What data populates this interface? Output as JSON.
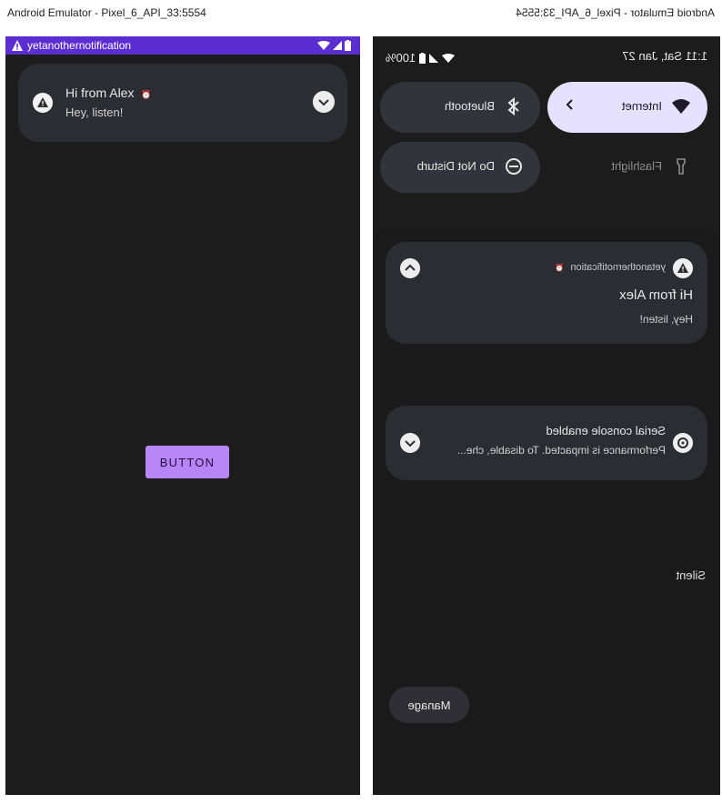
{
  "left_window": {
    "title": "Android Emulator - Pixel_6_API_33:5554",
    "app_bar": {
      "label": "yetanothernotification"
    },
    "notification": {
      "title": "Hi from Alex",
      "alarm_glyph": "⏰",
      "body": "Hey, listen!"
    },
    "button_label": "BUTTON"
  },
  "right_window": {
    "title": "Android Emulator - Pixel_6_API_33:5554",
    "status": {
      "time_date": "1:11 Sat, Jan 27",
      "battery": "100%"
    },
    "tiles": [
      {
        "label": "Internet",
        "icon": "wifi-icon",
        "state": "active"
      },
      {
        "label": "Bluetooth",
        "icon": "bluetooth-icon",
        "state": "inactive"
      },
      {
        "label": "Flashlight",
        "icon": "flashlight-icon",
        "state": "ghost"
      },
      {
        "label": "Do Not Disturb",
        "icon": "dnd-icon",
        "state": "inactive"
      }
    ],
    "notification": {
      "app": "yetanothernotification",
      "alarm_glyph": "⏰",
      "title": "Hi from Alex",
      "body": "Hey, listen!"
    },
    "section_label": "Silent",
    "silent_notification": {
      "title": "Serial console enabled",
      "body": "Performance is impacted. To disable, che..."
    },
    "manage_label": "Manage"
  },
  "colors": {
    "accent": "#5b2ed1",
    "button": "#b785f6",
    "tile_active": "#e6e1ff",
    "card": "#2c2c33"
  }
}
